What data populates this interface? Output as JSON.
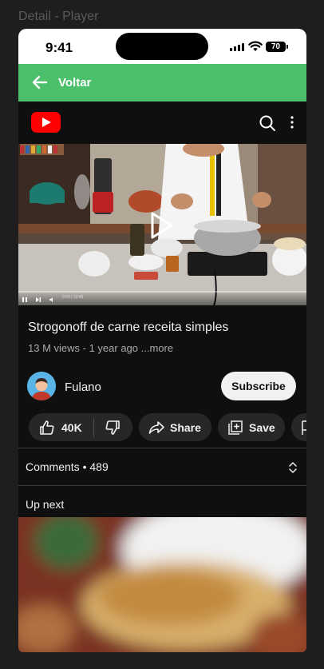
{
  "frame_label": "Detail - Player",
  "status_bar": {
    "time": "9:41",
    "battery": "70"
  },
  "appbar": {
    "back_label": "Voltar",
    "color": "#4cbf6a"
  },
  "player": {
    "time_readout": "0:00 / 10:45",
    "progress": 0.0
  },
  "video": {
    "title": "Strogonoff de carne receita simples",
    "meta": "13 M views - 1 year ago",
    "more": "...more"
  },
  "channel": {
    "name": "Fulano",
    "subscribe_label": "Subscribe"
  },
  "actions": {
    "likes": "40K",
    "share": "Share",
    "save": "Save"
  },
  "comments": {
    "label": "Comments",
    "count": "489"
  },
  "upnext": {
    "label": "Up next"
  },
  "icons": [
    "back-arrow-icon",
    "youtube-logo-icon",
    "search-icon",
    "more-vert-icon",
    "play-icon",
    "pause-icon",
    "next-icon",
    "volume-icon",
    "like-icon",
    "dislike-icon",
    "share-icon",
    "save-icon",
    "expand-icon"
  ]
}
